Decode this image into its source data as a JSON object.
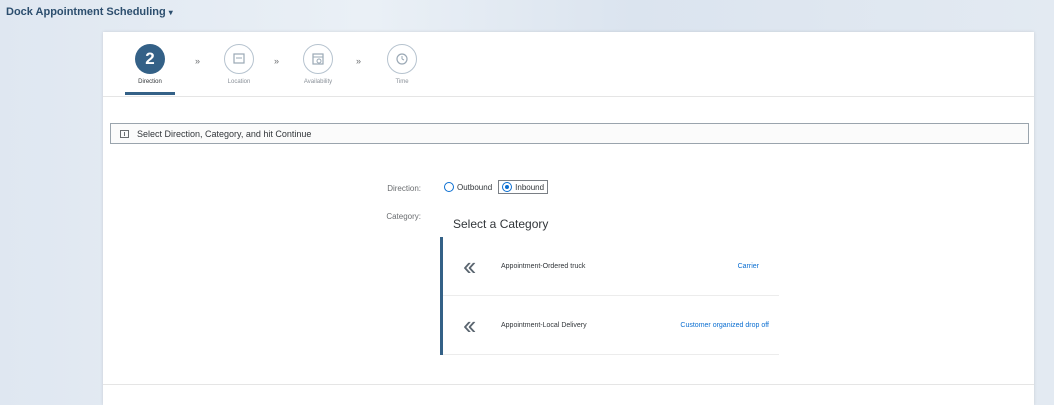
{
  "shell": {
    "app_title": "Dock Appointment Scheduling",
    "caret": "▾"
  },
  "wizard": {
    "steps": [
      {
        "number": "2",
        "label": "Direction",
        "icon": "direction-icon"
      },
      {
        "number": "",
        "label": "Location",
        "icon": "location-icon"
      },
      {
        "number": "",
        "label": "Availability",
        "icon": "calendar-icon"
      },
      {
        "number": "",
        "label": "Time",
        "icon": "clock-icon"
      }
    ],
    "separator": "»"
  },
  "instruction": {
    "text": "Select Direction, Category, and hit Continue"
  },
  "form": {
    "direction_label": "Direction:",
    "category_label": "Category:",
    "direction_options": [
      "Outbound",
      "Inbound"
    ],
    "selected_direction": "Inbound"
  },
  "category": {
    "title": "Select a Category",
    "items": [
      {
        "name": "Appointment-Ordered truck",
        "sub": "Carrier"
      },
      {
        "name": "Appointment-Local Delivery",
        "sub": "Customer organized drop off"
      }
    ]
  },
  "colors": {
    "accent": "#346187",
    "link": "#0a6ed1"
  }
}
